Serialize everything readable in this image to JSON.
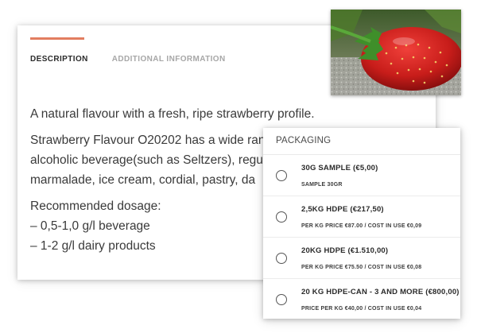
{
  "tabs": {
    "description": "DESCRIPTION",
    "additional_information": "ADDITIONAL INFORMATION"
  },
  "description": {
    "intro": "A natural flavour with a fresh, ripe strawberry profile.",
    "uses_lines": [
      "Strawberry Flavour O20202 has a wide ran",
      "alcoholic beverage(such as Seltzers), regu",
      "marmalade, ice cream, cordial, pastry, da"
    ],
    "dosage_title": "Recommended dosage:",
    "dosage_lines": [
      "– 0,5-1,0 g/l beverage",
      "– 1-2 g/l dairy products"
    ]
  },
  "packaging": {
    "title": "PACKAGING",
    "options": [
      {
        "name": "30G SAMPLE (€5,00)",
        "detail": "SAMPLE 30GR"
      },
      {
        "name": "2,5KG HDPE (€217,50)",
        "detail": "PER KG PRICE €87.00 / COST IN USE €0,09"
      },
      {
        "name": "20KG HDPE (€1.510,00)",
        "detail": "PER KG PRICE €75.50 / COST IN USE €0,08"
      },
      {
        "name": "20 KG HDPE-CAN - 3 AND MORE (€800,00)",
        "detail": "PRICE PER KG €40,00 / COST IN USE €0,04"
      }
    ]
  },
  "colors": {
    "accent": "#e27d60",
    "text": "#3a3a3a"
  },
  "icons": {
    "radio": "radio-unchecked-icon",
    "photo": "strawberry-photo"
  }
}
